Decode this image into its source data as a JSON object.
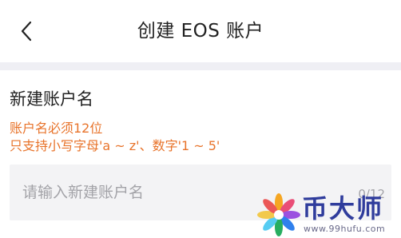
{
  "nav": {
    "back_icon": "chevron-left-icon",
    "title": "创建 EOS 账户"
  },
  "form": {
    "section_label": "新建账户名",
    "hints": [
      "账户名必须12位",
      "只支持小写字母'a ~ z'、数字'1 ~ 5'"
    ],
    "name_input": {
      "value": "",
      "placeholder": "请输入新建账户名",
      "counter": "0/12"
    }
  },
  "watermark": {
    "brand": "币大师",
    "url": "www.99hufu.com"
  },
  "colors": {
    "hint": "#e8732a",
    "separator": "#efeff4",
    "input_background": "#f3f3f5",
    "placeholder": "#a3a3a8",
    "watermark_brand": "#2f3c9c"
  }
}
